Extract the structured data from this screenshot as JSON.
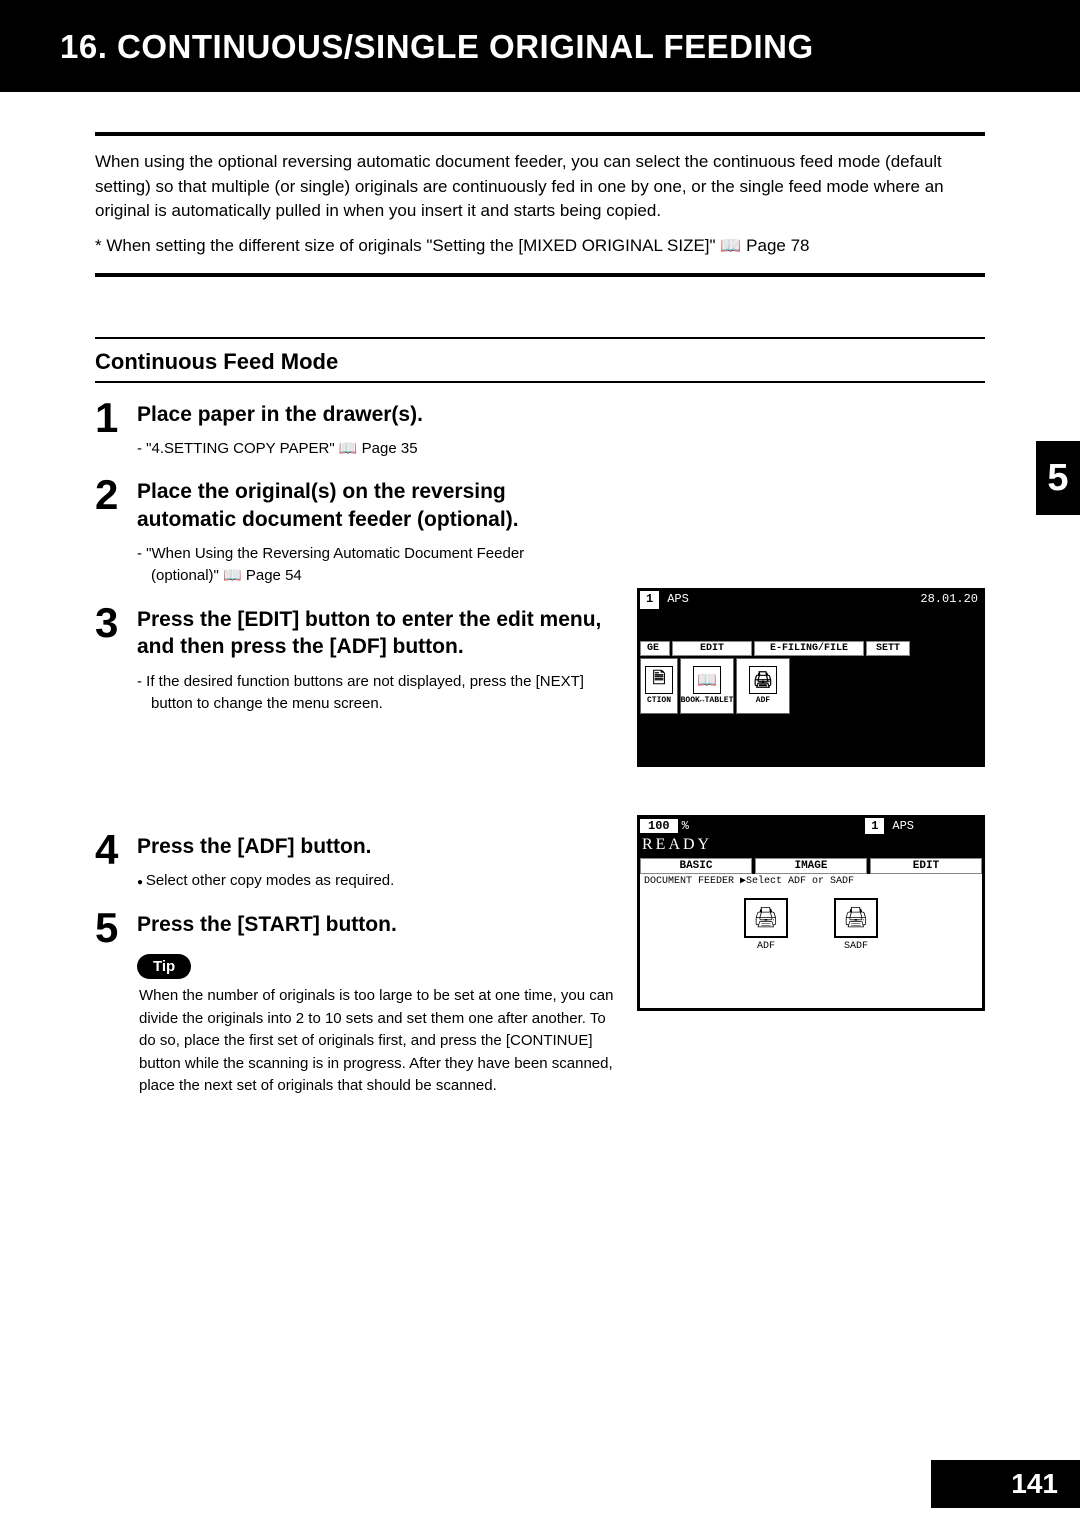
{
  "header": {
    "title": "16. CONTINUOUS/SINGLE ORIGINAL FEEDING"
  },
  "side_tab": "5",
  "page_number": "141",
  "intro": "When using the optional reversing automatic document feeder, you can select the continuous feed mode (default setting) so that multiple (or single) originals are continuously fed in one by one, or the single feed mode where an original is automatically pulled in when you insert it and starts being copied.",
  "note": "*  When setting the different size of originals \"Setting the [MIXED ORIGINAL SIZE]\"  📖  Page 78",
  "section_heading": "Continuous Feed Mode",
  "steps": {
    "s1": {
      "num": "1",
      "title": "Place paper in the drawer(s).",
      "sub": "\"4.SETTING COPY PAPER\"  📖  Page 35"
    },
    "s2": {
      "num": "2",
      "title": "Place the original(s) on the reversing automatic document feeder (optional).",
      "sub": "\"When Using the Reversing Automatic Document Feeder (optional)\"  📖  Page 54"
    },
    "s3": {
      "num": "3",
      "title": "Press the [EDIT] button to enter the edit menu, and then press the [ADF] button.",
      "sub": "If the desired function buttons are not displayed, press the [NEXT] button to change the menu screen."
    },
    "s4": {
      "num": "4",
      "title": "Press the [ADF] button.",
      "sub": "Select other copy modes as required."
    },
    "s5": {
      "num": "5",
      "title": "Press the [START] button."
    }
  },
  "tip": {
    "label": "Tip",
    "text": "When the number of originals is too large to be set at one time, you can divide the originals into 2 to 10 sets and set them one after another. To do so, place the first set of originals first, and press the [CONTINUE] button while the scanning is in progress. After they have been scanned, place the next set of originals that should be scanned."
  },
  "lcd1": {
    "badge": "1",
    "aps": "APS",
    "date": "28.01.20",
    "tabs": [
      "GE",
      "EDIT",
      "E-FILING/FILE",
      "SETT"
    ],
    "buttons": [
      "CTION",
      "BOOK↔TABLET",
      "ADF"
    ]
  },
  "lcd2": {
    "pct": "100",
    "pctsym": "%",
    "badge": "1",
    "aps": "APS",
    "ready": "READY",
    "tabs": [
      "BASIC",
      "IMAGE",
      "EDIT"
    ],
    "line": "DOCUMENT FEEDER  ▶Select ADF or SADF",
    "buttons": [
      "ADF",
      "SADF"
    ]
  }
}
